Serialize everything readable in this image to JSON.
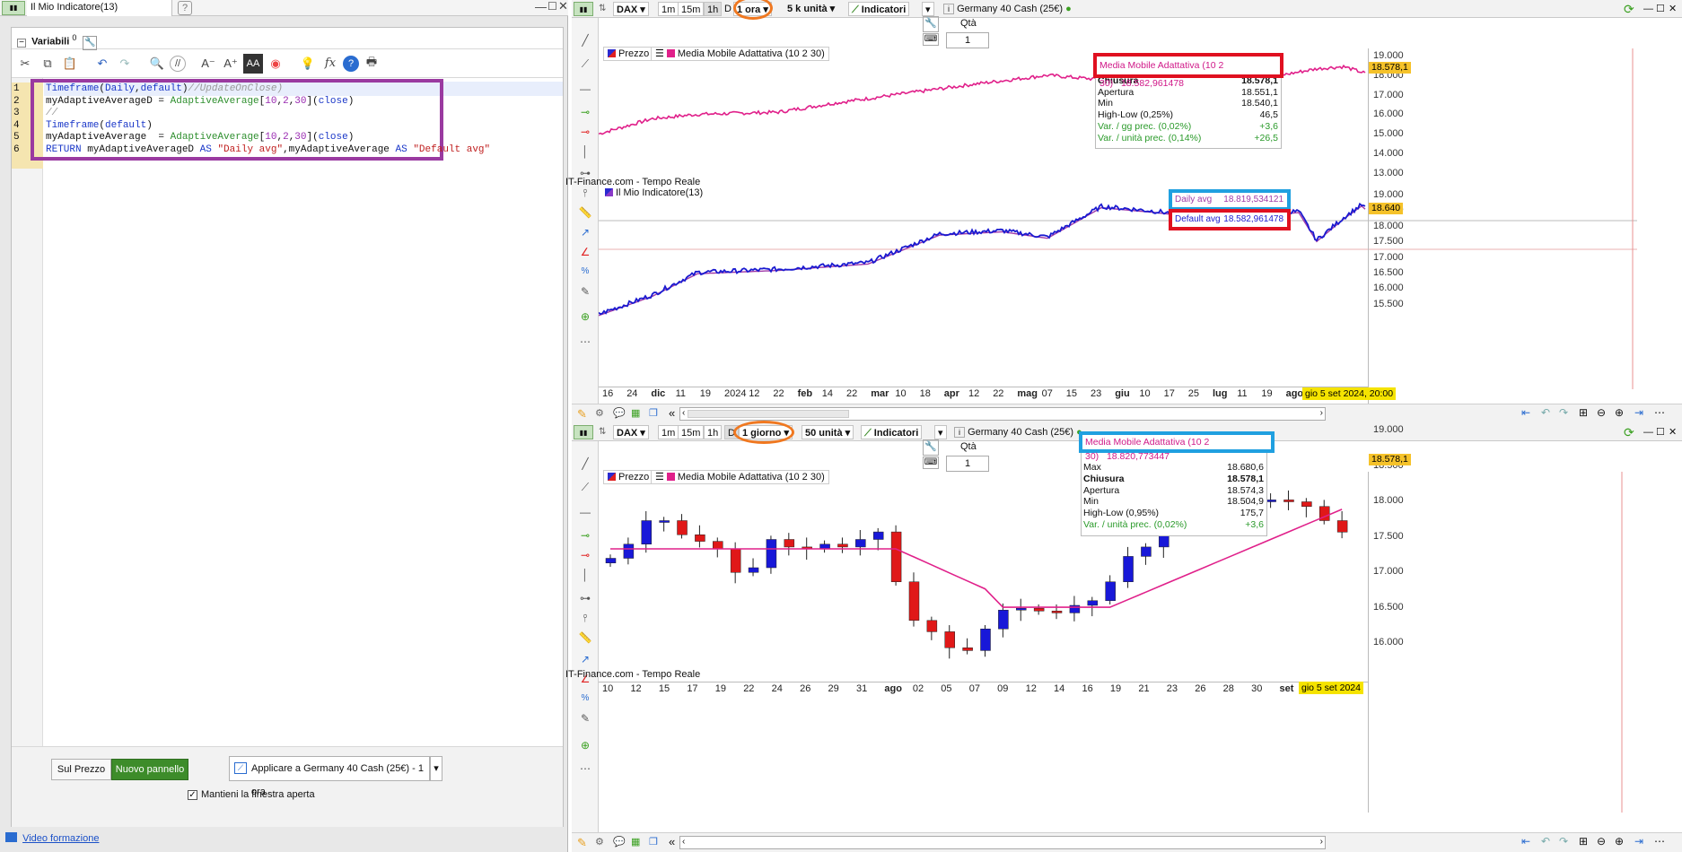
{
  "editor": {
    "tab_title": "Il Mio Indicatore(13)",
    "variables_label": "Variabili",
    "variables_count": "0",
    "code_lines": [
      {
        "num": "1",
        "code": "Timeframe(Daily,default)//UpdateOnClose)"
      },
      {
        "num": "2",
        "code": "myAdaptiveAverageD = AdaptiveAverage[10,2,30](close)"
      },
      {
        "num": "3",
        "code": "//"
      },
      {
        "num": "4",
        "code": "Timeframe(default)"
      },
      {
        "num": "5",
        "code": "myAdaptiveAverage  = AdaptiveAverage[10,2,30](close)"
      },
      {
        "num": "6",
        "code": "RETURN myAdaptiveAverageD AS \"Daily avg\",myAdaptiveAverage AS \"Default avg\""
      }
    ],
    "btn_on_price": "Sul Prezzo",
    "btn_new_panel": "Nuovo pannello",
    "btn_apply": "Applicare a Germany 40 Cash (25€) - 1 ora",
    "keep_open_label": "Mantieni la finestra aperta",
    "video_link": "Video formazione"
  },
  "chart1": {
    "symbol": "DAX",
    "timeframes": [
      "1m",
      "15m",
      "1h",
      "D"
    ],
    "timeframe_selected": "1 ora",
    "units": "5 k unità",
    "indicators_label": "Indicatori",
    "instrument": "Germany 40 Cash (25€)",
    "qty_label": "Qtà",
    "qty_value": "1",
    "legend_price": "Prezzo",
    "legend_ma": "Media Mobile Adattativa (10 2 30)",
    "source": "IT-Finance.com - Tempo Reale",
    "indicator_legend": "Il Mio Indicatore(13)",
    "ma_value_label": "Media Mobile Adattativa (10 2 30)",
    "ma_value": "18.582,961478",
    "info_rows": [
      {
        "label": "Max",
        "value": "18.580,0"
      },
      {
        "label": "Chiusura",
        "value": "18.578,1"
      },
      {
        "label": "Apertura",
        "value": "18.551,1"
      },
      {
        "label": "Min",
        "value": "18.540,1"
      },
      {
        "label": "High-Low (0,25%)",
        "value": "46,5"
      },
      {
        "label": "Var. / gg prec. (0,02%)",
        "value": "+3,6"
      },
      {
        "label": "Var. / unità prec. (0,14%)",
        "value": "+26,5"
      }
    ],
    "daily_avg_label": "Daily avg",
    "daily_avg_value": "18.819,534121",
    "default_avg_label": "Default avg",
    "default_avg_value": "18.582,961478",
    "price_tag": "18.578,1",
    "ind_tag": "18.640",
    "date_tag": "gio 5 set 2024, 20:00",
    "y_top": [
      "19.000",
      "18.000",
      "17.000",
      "16.000",
      "15.000",
      "14.000",
      "13.000"
    ],
    "y_bot": [
      "19.000",
      "18.500",
      "18.000",
      "17.500",
      "17.000",
      "16.500",
      "16.000",
      "15.500"
    ],
    "x_labels": [
      "16",
      "24",
      "dic",
      "11",
      "19",
      "2024",
      "12",
      "22",
      "feb",
      "14",
      "22",
      "mar",
      "10",
      "18",
      "apr",
      "12",
      "22",
      "mag",
      "07",
      "15",
      "23",
      "giu",
      "10",
      "17",
      "25",
      "lug",
      "11",
      "19",
      "ago",
      "13",
      "21"
    ]
  },
  "chart2": {
    "symbol": "DAX",
    "timeframes": [
      "1m",
      "15m",
      "1h",
      "D"
    ],
    "timeframe_selected": "1 giorno",
    "units": "50 unità",
    "indicators_label": "Indicatori",
    "instrument": "Germany 40 Cash (25€)",
    "qty_label": "Qtà",
    "qty_value": "1",
    "legend_price": "Prezzo",
    "legend_ma": "Media Mobile Adattativa (10 2 30)",
    "source": "IT-Finance.com - Tempo Reale",
    "ma_value_label": "Media Mobile Adattativa (10 2 30)",
    "ma_value": "18.820,773447",
    "info_rows": [
      {
        "label": "Max",
        "value": "18.680,6"
      },
      {
        "label": "Chiusura",
        "value": "18.578,1"
      },
      {
        "label": "Apertura",
        "value": "18.574,3"
      },
      {
        "label": "Min",
        "value": "18.504,9"
      },
      {
        "label": "High-Low (0,95%)",
        "value": "175,7"
      },
      {
        "label": "Var. / unità prec. (0,02%)",
        "value": "+3,6"
      }
    ],
    "price_tag": "18.578,1",
    "date_tag": "gio 5 set 2024",
    "y_labels": [
      "19.000",
      "18.500",
      "18.000",
      "17.500",
      "17.000",
      "16.500",
      "16.000"
    ],
    "x_labels": [
      "10",
      "12",
      "15",
      "17",
      "19",
      "22",
      "24",
      "26",
      "29",
      "31",
      "ago",
      "02",
      "05",
      "07",
      "09",
      "12",
      "14",
      "16",
      "19",
      "21",
      "23",
      "26",
      "28",
      "30",
      "set",
      "02"
    ]
  },
  "colors": {
    "accent_green": "#3d8c2a",
    "price_line": "#e0208a",
    "indicator_blue": "#1a1ad0",
    "indicator_purple": "#a03aa8",
    "candle_up": "#1818d8",
    "candle_down": "#e01818",
    "highlight_red": "#e01020",
    "highlight_blue": "#20a0e0",
    "highlight_orange": "#f07820",
    "highlight_purple": "#9a3aa0"
  }
}
